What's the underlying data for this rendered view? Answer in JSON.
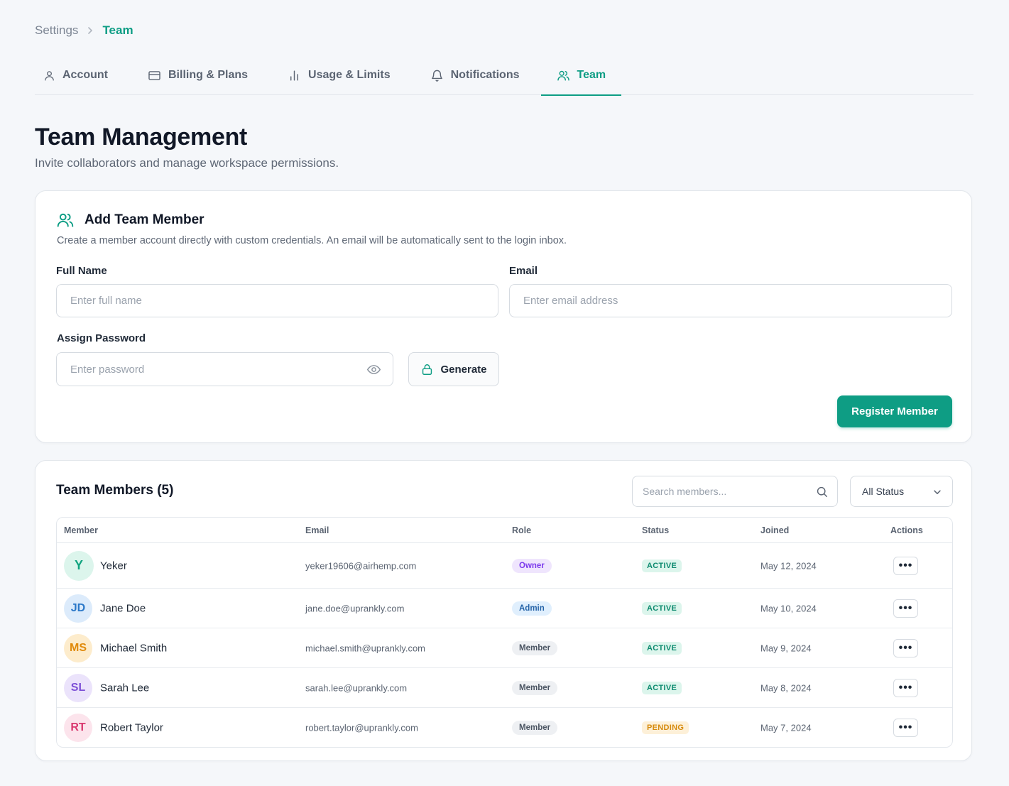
{
  "breadcrumb": {
    "parent": "Settings",
    "current": "Team"
  },
  "tabs": [
    {
      "label": "Account",
      "icon": "user-icon",
      "active": false
    },
    {
      "label": "Billing & Plans",
      "icon": "credit-card-icon",
      "active": false
    },
    {
      "label": "Usage & Limits",
      "icon": "bar-chart-icon",
      "active": false
    },
    {
      "label": "Notifications",
      "icon": "bell-icon",
      "active": false
    },
    {
      "label": "Team",
      "icon": "users-icon",
      "active": true
    }
  ],
  "page": {
    "title": "Team Management",
    "subtitle": "Invite collaborators and manage workspace permissions."
  },
  "add_member": {
    "title": "Add Team Member",
    "description": "Create a member account directly with custom credentials. An email will be automatically sent to the login inbox.",
    "full_name_label": "Full Name",
    "full_name_placeholder": "Enter full name",
    "email_label": "Email",
    "email_placeholder": "Enter email address",
    "password_label": "Assign Password",
    "password_placeholder": "Enter password",
    "generate_label": "Generate",
    "register_label": "Register Member"
  },
  "members": {
    "title": "Team Members (5)",
    "search_placeholder": "Search members...",
    "status_filter": "All Status",
    "columns": {
      "member": "Member",
      "email": "Email",
      "role": "Role",
      "status": "Status",
      "joined": "Joined",
      "actions": "Actions"
    },
    "actions_label": "•••",
    "rows": [
      {
        "initials": "Y",
        "name": "Yeker",
        "email": "yeker19606@airhemp.com",
        "role": "Owner",
        "status": "ACTIVE",
        "joined": "May 12, 2024"
      },
      {
        "initials": "JD",
        "name": "Jane Doe",
        "email": "jane.doe@uprankly.com",
        "role": "Admin",
        "status": "ACTIVE",
        "joined": "May 10, 2024"
      },
      {
        "initials": "MS",
        "name": "Michael Smith",
        "email": "michael.smith@uprankly.com",
        "role": "Member",
        "status": "ACTIVE",
        "joined": "May 9, 2024"
      },
      {
        "initials": "SL",
        "name": "Sarah Lee",
        "email": "sarah.lee@uprankly.com",
        "role": "Member",
        "status": "ACTIVE",
        "joined": "May 8, 2024"
      },
      {
        "initials": "RT",
        "name": "Robert Taylor",
        "email": "robert.taylor@uprankly.com",
        "role": "Member",
        "status": "PENDING",
        "joined": "May 7, 2024"
      }
    ]
  },
  "colors": {
    "accent": "#0d9d84",
    "avatar_y": "#dcf5ec",
    "avatar_y_text": "#10a37f",
    "avatar_jd": "#dcebfb",
    "avatar_jd_text": "#2b78c8",
    "avatar_ms": "#fdeccc",
    "avatar_ms_text": "#e08a0b",
    "avatar_sl": "#ebe3fb",
    "avatar_sl_text": "#7c4fd6",
    "avatar_rt": "#fce4ec",
    "avatar_rt_text": "#d9376e",
    "owner_bg": "#efe5fd",
    "owner_text": "#7c3aed",
    "admin_bg": "#e0effd",
    "admin_text": "#2563a8",
    "member_bg": "#eef0f3",
    "member_text": "#4b5563",
    "active_bg": "#dcf5ec",
    "active_text": "#0d8a6f",
    "pending_bg": "#fdf0d8",
    "pending_text": "#d68a0c"
  }
}
